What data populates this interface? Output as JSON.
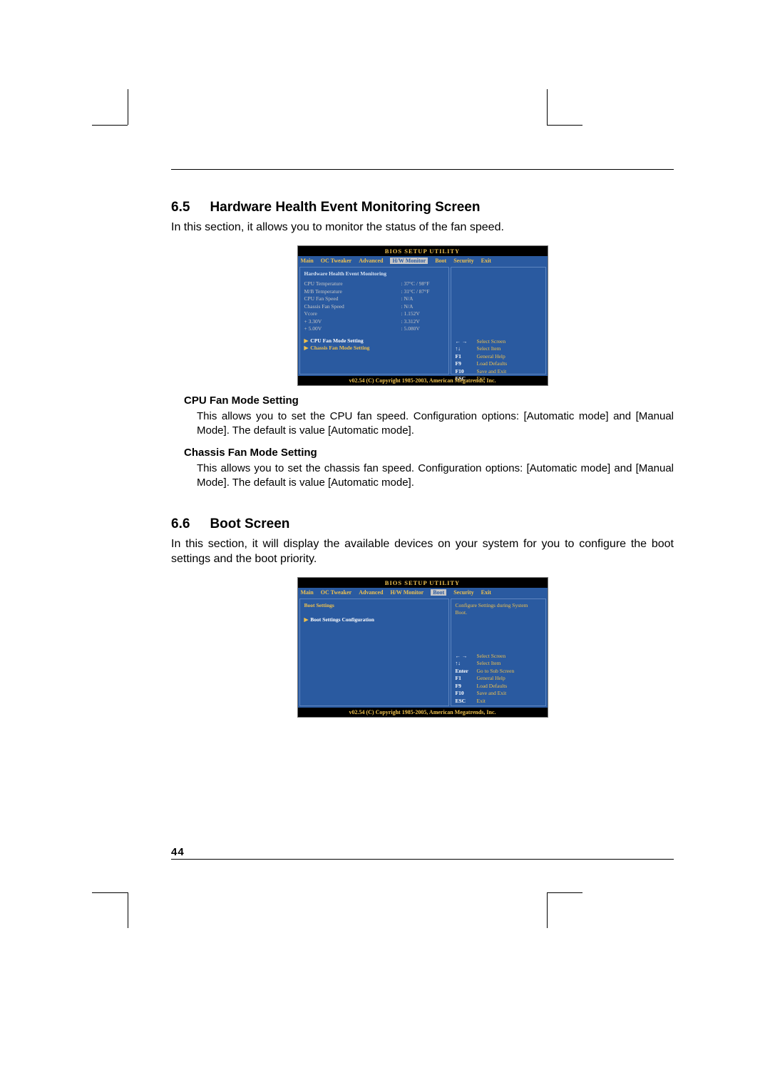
{
  "page_number": "44",
  "section65": {
    "num": "6.5",
    "title": "Hardware Health Event Monitoring Screen",
    "intro": "In this section, it allows you to monitor the status of the fan speed.",
    "sub1_title": "CPU Fan Mode Setting",
    "sub1_text": "This allows you to set the CPU fan speed. Configuration options: [Automatic mode] and [Manual Mode]. The default is value [Automatic mode].",
    "sub2_title": "Chassis Fan Mode Setting",
    "sub2_text": "This allows you to set the chassis fan speed. Configuration options: [Automatic mode] and [Manual Mode]. The default is value [Automatic mode]."
  },
  "section66": {
    "num": "6.6",
    "title": "Boot Screen",
    "intro": "In this section, it will display the available devices on your system for you to configure the boot settings and the boot priority."
  },
  "bios_common": {
    "title": "BIOS SETUP UTILITY",
    "tabs": [
      "Main",
      "OC Tweaker",
      "Advanced",
      "H/W Monitor",
      "Boot",
      "Security",
      "Exit"
    ]
  },
  "bios1": {
    "active_tab": "H/W Monitor",
    "pane_title": "Hardware Health Event Monitoring",
    "rows": [
      {
        "k": "CPU Temperature",
        "v": ": 37°C / 98°F"
      },
      {
        "k": "M/B Temperature",
        "v": ": 31°C / 87°F"
      },
      {
        "k": "",
        "v": ""
      },
      {
        "k": "CPU Fan Speed",
        "v": ": N/A"
      },
      {
        "k": "Chassis Fan Speed",
        "v": ": N/A"
      },
      {
        "k": "",
        "v": ""
      },
      {
        "k": "Vcore",
        "v": ": 1.152V"
      },
      {
        "k": "+  3.30V",
        "v": ": 3.312V"
      },
      {
        "k": "+  5.00V",
        "v": ": 5.080V"
      }
    ],
    "hot1": "CPU Fan Mode Setting",
    "hot2": "Chassis Fan Mode Setting",
    "help": [
      {
        "k": "← →",
        "v": "Select Screen"
      },
      {
        "k": "↑↓",
        "v": "Select Item"
      },
      {
        "k": "F1",
        "v": "General Help"
      },
      {
        "k": "F9",
        "v": "Load Defaults"
      },
      {
        "k": "F10",
        "v": "Save and Exit"
      },
      {
        "k": "ESC",
        "v": "Exit"
      }
    ],
    "footer": "v02.54 (C) Copyright 1985-2003, American Megatrends, Inc."
  },
  "bios2": {
    "active_tab": "Boot",
    "pane_title": "Boot Settings",
    "hot1": "Boot Settings Configuration",
    "desc": "Configure Settings during System Boot.",
    "help": [
      {
        "k": "← →",
        "v": "Select Screen"
      },
      {
        "k": "↑↓",
        "v": "Select Item"
      },
      {
        "k": "Enter",
        "v": "Go to Sub Screen"
      },
      {
        "k": "F1",
        "v": "General Help"
      },
      {
        "k": "F9",
        "v": "Load Defaults"
      },
      {
        "k": "F10",
        "v": "Save and Exit"
      },
      {
        "k": "ESC",
        "v": "Exit"
      }
    ],
    "footer": "v02.54 (C) Copyright 1985-2005, American Megatrends, Inc."
  }
}
